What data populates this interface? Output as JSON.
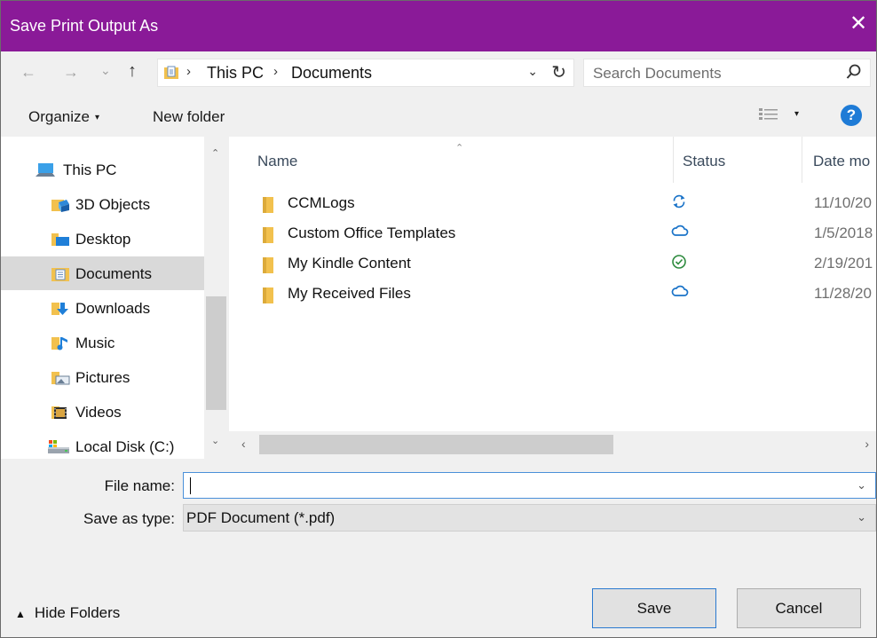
{
  "window": {
    "title": "Save Print Output As",
    "close_glyph": "✕"
  },
  "nav": {
    "back_glyph": "←",
    "forward_glyph": "→",
    "recent_glyph": "⌄",
    "up_glyph": "↑"
  },
  "address": {
    "crumbs": [
      {
        "label": "This PC"
      },
      {
        "label": "Documents"
      }
    ],
    "sep_glyph": "›",
    "dropdown_glyph": "⌄",
    "refresh_glyph": "↻"
  },
  "search": {
    "placeholder": "Search Documents"
  },
  "toolbar": {
    "organize_label": "Organize",
    "new_folder_label": "New folder",
    "help_label": "?",
    "caret_glyph": "▾"
  },
  "nav_pane": {
    "items": [
      {
        "label": "This PC",
        "icon": "computer-icon",
        "selected": false
      },
      {
        "label": "3D Objects",
        "icon": "3d-objects-folder-icon",
        "selected": false
      },
      {
        "label": "Desktop",
        "icon": "desktop-folder-icon",
        "selected": false
      },
      {
        "label": "Documents",
        "icon": "documents-folder-icon",
        "selected": true
      },
      {
        "label": "Downloads",
        "icon": "downloads-folder-icon",
        "selected": false
      },
      {
        "label": "Music",
        "icon": "music-folder-icon",
        "selected": false
      },
      {
        "label": "Pictures",
        "icon": "pictures-folder-icon",
        "selected": false
      },
      {
        "label": "Videos",
        "icon": "videos-folder-icon",
        "selected": false
      },
      {
        "label": "Local Disk (C:)",
        "icon": "local-disk-icon",
        "selected": false
      }
    ]
  },
  "file_list": {
    "columns": {
      "name": "Name",
      "status": "Status",
      "date": "Date mo"
    },
    "rows": [
      {
        "name": "CCMLogs",
        "status": "sync-pending-icon",
        "date": "11/10/20"
      },
      {
        "name": "Custom Office Templates",
        "status": "cloud-icon",
        "date": "1/5/2018"
      },
      {
        "name": "My Kindle Content",
        "status": "synced-check-icon",
        "date": "2/19/201"
      },
      {
        "name": "My Received Files",
        "status": "cloud-icon",
        "date": "11/28/20"
      }
    ]
  },
  "scroll": {
    "up_glyph": "⌃",
    "down_glyph": "⌄",
    "left_glyph": "‹",
    "right_glyph": "›"
  },
  "form": {
    "file_name_label": "File name:",
    "file_name_value": "",
    "save_type_label": "Save as type:",
    "save_type_value": "PDF Document (*.pdf)",
    "dropdown_glyph": "⌄"
  },
  "footer": {
    "hide_folders_label": "Hide Folders",
    "hide_glyph": "▲",
    "save_label": "Save",
    "cancel_label": "Cancel"
  },
  "colors": {
    "title_bar": "#8a1a98",
    "help_blue": "#1e7bd6",
    "folder": "#f2c14e",
    "sync_blue": "#1a73c8",
    "check_green": "#2e8b3e"
  }
}
